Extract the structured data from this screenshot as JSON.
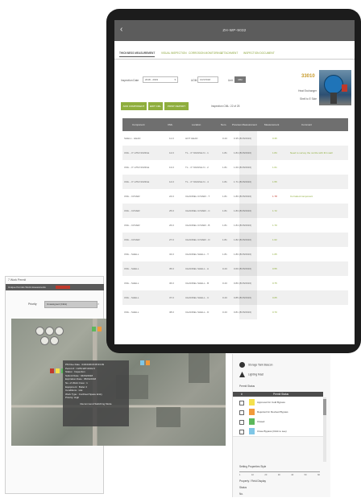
{
  "map_app": {
    "title": "7 Work Permit",
    "bar_text": "Unique Permits Work Assessments",
    "filter_label": "Priority",
    "filter_value": "Unassigned (Click)",
    "close": "×",
    "popup": [
      "PM Due Date : 04/04/2018 08:33:39",
      "Permit # : CWS-WP-0001-5",
      "Status : Inspection",
      "Submit Date : 04/04/2018",
      "Expiration Date : 05/04/2018",
      "No. of Work Crew : 1",
      "Equipment : Boiler 2",
      "Conditions : Hot",
      "Work Type : Confined Space Entry",
      "Priority: High",
      "Recommend Switching Mode"
    ]
  },
  "right_panel": {
    "items": [
      "Storage Tank Beacon",
      "Lighting Mast"
    ],
    "section_label": "Permit Status",
    "head": [
      "#",
      "Permit Status"
    ],
    "rows": [
      {
        "label": "Approved for Cold Bypass",
        "color": "#f4e04d"
      },
      {
        "label": "Rejected for Revised Bypass",
        "color": "#f29a3a"
      },
      {
        "label": "Closed",
        "color": "#5cb85c"
      },
      {
        "label": "Close Bypass (Click to see)",
        "color": "#7fc6e6"
      }
    ],
    "opacity_label": "Setting Properties Style",
    "scale": [
      "1",
      "10",
      "20",
      "30",
      "40",
      "50",
      "60"
    ],
    "props_label": "Property / Field Display",
    "props": [
      "Status",
      "No."
    ]
  },
  "tablet": {
    "title": "ZH-WP-9032",
    "tabs": [
      "THICKNESS MEASUREMENT",
      "VISUAL INSPECTION",
      "CORROSION MONITORING",
      "ATTACHMENT",
      "INSPECTION DOCUMENT"
    ],
    "filters": {
      "date_label": "Inspection Date",
      "date_value": "2018 - 2019",
      "unit_label": "UOM",
      "unit_value": "CUSTOM",
      "mode_label": "Unit",
      "mode_button": "MM"
    },
    "info": {
      "number": "33010",
      "line1": "Heat Exchanger",
      "line2": "Shell to E Side"
    },
    "buttons": [
      "ADD COMPONENT",
      "EDIT CML",
      "PRINT REPORT PAGE"
    ],
    "inspection_label": "Inspection CML: 22 of 25",
    "table": {
      "headers": [
        "Component",
        "CML",
        "Location",
        "Nom.",
        "Previous Measurement",
        "Measurement",
        "Comment"
      ],
      "rows": [
        {
          "c": "SHELL - HEAD",
          "cml": "11.0",
          "loc": "HOT HEAD",
          "nom": "0.43",
          "prev": "0.35 (8/15/2016)",
          "m": "0.35",
          "mc": "",
          "cm": ""
        },
        {
          "c": "CML - 4\" LPM NOZZLE",
          "cml": "12.0",
          "loc": "TL - 4\" NOZZLE N - 1",
          "nom": "1.81",
          "prev": "1.84 (8/15/2016)",
          "m": "1.84",
          "mc": "",
          "cm": "Need to survey the nozzle with thin wall"
        },
        {
          "c": "CML - 4\" LPM NOZZLE",
          "cml": "13.0",
          "loc": "TL - 4\" NOZZLE N - 2",
          "nom": "1.81",
          "prev": "1.60 (8/15/2016)",
          "m": "1.61",
          "mc": "",
          "cm": ""
        },
        {
          "c": "CML - 4\" LPM NOZZLE",
          "cml": "14.0",
          "loc": "TL - 4\" NOZZLE N - 4",
          "nom": "1.81",
          "prev": "1.71 (8/15/2016)",
          "m": "1.55",
          "mc": "",
          "cm": ""
        },
        {
          "c": "CML - COVER",
          "cml": "24.0",
          "loc": "CHANNEL COVER - T",
          "nom": "1.81",
          "prev": "1.80 (8/15/2016)",
          "m": "1.78",
          "mc": "red",
          "cm": "Corroded component"
        },
        {
          "c": "CML - COVER",
          "cml": "25.0",
          "loc": "CHANNEL COVER - C",
          "nom": "1.81",
          "prev": "1.83 (8/15/2016)",
          "m": "1.72",
          "mc": "",
          "cm": ""
        },
        {
          "c": "CML - COVER",
          "cml": "26.0",
          "loc": "CHANNEL COVER - B",
          "nom": "1.81",
          "prev": "1.84 (8/15/2016)",
          "m": "1.70",
          "mc": "",
          "cm": ""
        },
        {
          "c": "CML - COVER",
          "cml": "27.0",
          "loc": "CHANNEL COVER - D",
          "nom": "1.81",
          "prev": "1.82 (8/15/2016)",
          "m": "1.62",
          "mc": "",
          "cm": ""
        },
        {
          "c": "CML - SHELL",
          "cml": "34.0",
          "loc": "CHANNEL SHELL - T",
          "nom": "1.81",
          "prev": "1.80 (8/15/2016)",
          "m": "1.65",
          "mc": "",
          "cm": ""
        },
        {
          "c": "CML - SHELL",
          "cml": "35.0",
          "loc": "CHANNEL SHELL - A",
          "nom": "0.43",
          "prev": "0.60 (8/15/2016)",
          "m": "0.55",
          "mc": "",
          "cm": ""
        },
        {
          "c": "CML - SHELL",
          "cml": "36.0",
          "loc": "CHANNEL SHELL - B",
          "nom": "0.43",
          "prev": "0.80 (8/15/2016)",
          "m": "0.75",
          "mc": "",
          "cm": ""
        },
        {
          "c": "CML - SHELL",
          "cml": "37.0",
          "loc": "CHANNEL SHELL - C",
          "nom": "0.43",
          "prev": "0.85 (8/15/2016)",
          "m": "0.65",
          "mc": "",
          "cm": ""
        },
        {
          "c": "CML - SHELL",
          "cml": "38.0",
          "loc": "CHANNEL SHELL - D",
          "nom": "0.43",
          "prev": "0.81 (8/15/2016)",
          "m": "0.70",
          "mc": "",
          "cm": ""
        }
      ]
    }
  },
  "colors": {
    "accent": "#8fae3d",
    "header": "#5c5c5c",
    "alert": "#c0392b",
    "number": "#c79a2a"
  }
}
